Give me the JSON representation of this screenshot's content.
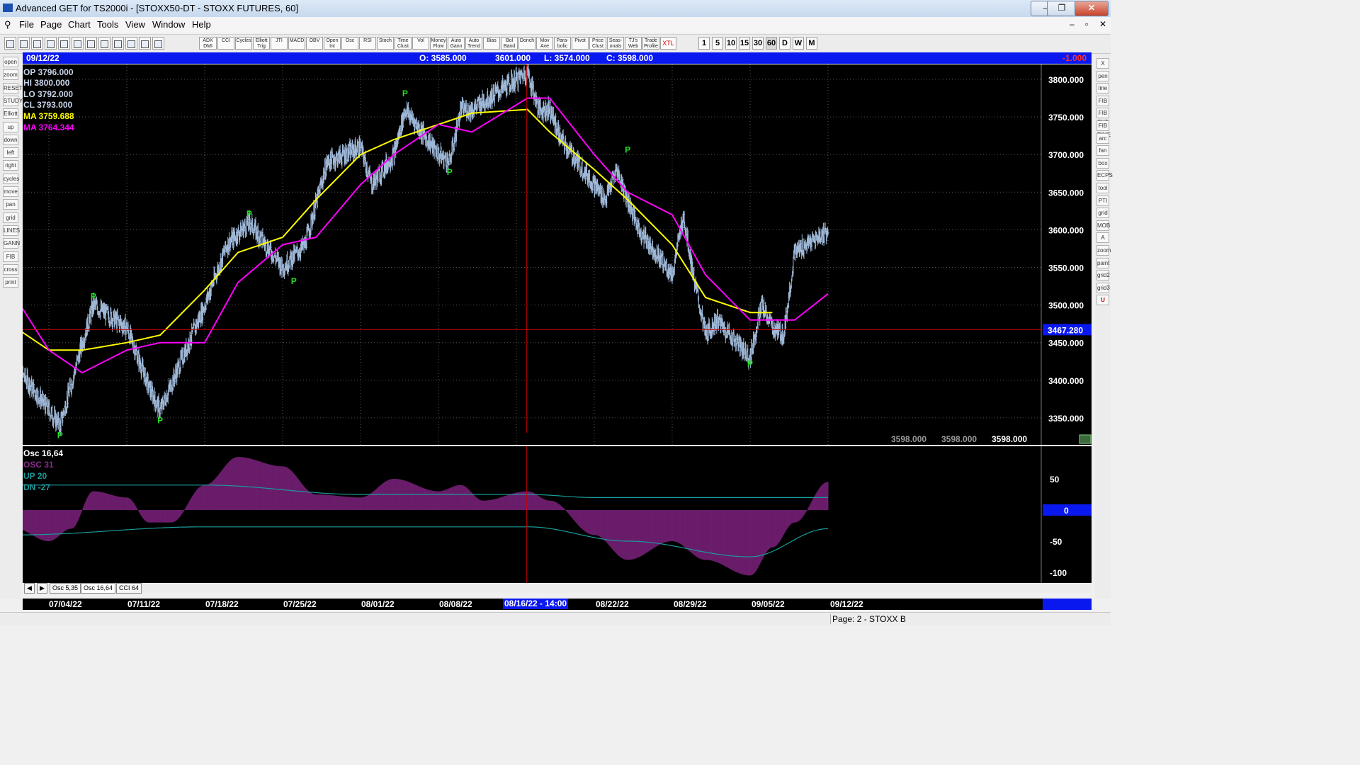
{
  "window": {
    "title": "Advanced GET for TS2000i - [STOXX50-DT - STOXX FUTURES, 60]",
    "controls": [
      "–",
      "❐",
      "✕"
    ],
    "child_controls": [
      "–",
      "▫",
      "✕"
    ]
  },
  "menu": [
    "File",
    "Page",
    "Chart",
    "Tools",
    "View",
    "Window",
    "Help"
  ],
  "toolbar": {
    "indicators": [
      "ADX DMI",
      "CCI",
      "Cycles",
      "Elliott Trig",
      "JTI",
      "MACD",
      "OBV",
      "Open Int",
      "Osc",
      "RSI",
      "Stoch",
      "Time Clust",
      "Vol",
      "Money Flow",
      "Auto Gann",
      "Auto Trend",
      "Bias",
      "Bol Band",
      "Donch",
      "Mov Ave",
      "Para-bolic",
      "Pivot",
      "Price Clust",
      "Seas-onals",
      "TJ's Web",
      "Trade Profile",
      "XTL"
    ],
    "timeframes": [
      "1",
      "5",
      "10",
      "15",
      "30",
      "60",
      "D",
      "W",
      "M"
    ],
    "left_icons": [
      "pin-icon",
      "quote-icon",
      "new-icon",
      "open-icon",
      "prev-icon",
      "next-icon",
      "refresh-icon",
      "grid-icon",
      "save-icon",
      "print-icon",
      "help-icon",
      "help-arrow-icon"
    ]
  },
  "left_tools": [
    "open",
    "zoom",
    "RESET",
    "STUDY",
    "Elliott",
    "up",
    "down",
    "left",
    "right",
    "cycles",
    "move",
    "pan",
    "grid",
    "LINES",
    "GANN",
    "FIB",
    "cross",
    "print"
  ],
  "right_tools": [
    "X",
    "pen",
    "line",
    "FIB RET",
    "FIB EXT",
    "FIB TIME",
    "arc",
    "fan",
    "box",
    "ECPS",
    "tool",
    "PTI",
    "grid",
    "MOB",
    "A",
    "zoom",
    "paint",
    "grid2",
    "grid3",
    "U"
  ],
  "info_bar": {
    "date": "09/12/22",
    "open": "O: 3585.000",
    "high": "3601.000",
    "low": "L: 3574.000",
    "close": "C: 3598.000",
    "change": "-1.000"
  },
  "legend": {
    "op": "OP  3796.000",
    "hi": "HI   3800.000",
    "lo": "LO  3792.000",
    "cl": "CL  3793.000",
    "ma1": "MA  3759.688",
    "ma2": "MA  3764.344",
    "osc_title": "Osc 16,64",
    "osc": "OSC 31",
    "up": "UP  20",
    "dn": "DN  -27"
  },
  "price_axis": {
    "ticks": [
      "3800.000",
      "3750.000",
      "3700.000",
      "3650.000",
      "3600.000",
      "3550.000",
      "3500.000",
      "3450.000",
      "3400.000",
      "3350.000"
    ],
    "cursor_label": "3467.280",
    "bottom_values": [
      "3598.000",
      "3598.000",
      "3598.000"
    ]
  },
  "osc_axis": {
    "ticks": [
      "50",
      "0",
      "-50",
      "-100"
    ]
  },
  "pivot_label": "P",
  "tabs": [
    "Osc 5,35",
    "Osc 16,64",
    "CCI 64"
  ],
  "date_axis": [
    "07/04/22",
    "07/11/22",
    "07/18/22",
    "07/25/22",
    "08/01/22",
    "08/08/22",
    "08/16/22 - 14:00",
    "08/22/22",
    "08/29/22",
    "09/05/22",
    "09/12/22"
  ],
  "status": {
    "page": "Page: 2 - STOXX B"
  },
  "colors": {
    "info_bar": "#0a18f0",
    "bars": "#9fb8d8",
    "ma_yellow": "#ffff00",
    "ma_magenta": "#ff00ff",
    "osc_hist": "#6a1d6a",
    "band": "#1a9a9a",
    "pivot": "#22e022",
    "cursor": "#cc0000"
  },
  "chart_data": {
    "type": "line",
    "x": [
      "07/04/22",
      "07/11/22",
      "07/18/22",
      "07/25/22",
      "08/01/22",
      "08/08/22",
      "08/16/22",
      "08/22/22",
      "08/29/22",
      "09/05/22",
      "09/12/22"
    ],
    "ylim": [
      3330,
      3820
    ],
    "series": [
      {
        "name": "Price (hourly)",
        "points": [
          [
            "07/01/22",
            3420
          ],
          [
            "07/05/22",
            3340
          ],
          [
            "07/07/22",
            3450
          ],
          [
            "07/08/22",
            3500
          ],
          [
            "07/11/22",
            3470
          ],
          [
            "07/13/22",
            3390
          ],
          [
            "07/14/22",
            3360
          ],
          [
            "07/18/22",
            3500
          ],
          [
            "07/20/22",
            3580
          ],
          [
            "07/22/22",
            3610
          ],
          [
            "07/25/22",
            3550
          ],
          [
            "07/27/22",
            3580
          ],
          [
            "07/29/22",
            3690
          ],
          [
            "08/01/22",
            3710
          ],
          [
            "08/02/22",
            3660
          ],
          [
            "08/04/22",
            3700
          ],
          [
            "08/05/22",
            3760
          ],
          [
            "08/08/22",
            3700
          ],
          [
            "08/09/22",
            3690
          ],
          [
            "08/10/22",
            3760
          ],
          [
            "08/11/22",
            3760
          ],
          [
            "08/12/22",
            3770
          ],
          [
            "08/16/22",
            3810
          ],
          [
            "08/17/22",
            3760
          ],
          [
            "08/18/22",
            3760
          ],
          [
            "08/19/22",
            3720
          ],
          [
            "08/22/22",
            3660
          ],
          [
            "08/23/22",
            3640
          ],
          [
            "08/24/22",
            3680
          ],
          [
            "08/25/22",
            3640
          ],
          [
            "08/26/22",
            3600
          ],
          [
            "08/29/22",
            3540
          ],
          [
            "08/30/22",
            3620
          ],
          [
            "08/31/22",
            3530
          ],
          [
            "09/01/22",
            3460
          ],
          [
            "09/02/22",
            3480
          ],
          [
            "09/05/22",
            3430
          ],
          [
            "09/06/22",
            3500
          ],
          [
            "09/07/22",
            3470
          ],
          [
            "09/08/22",
            3460
          ],
          [
            "09/09/22",
            3570
          ],
          [
            "09/12/22",
            3598
          ]
        ]
      },
      {
        "name": "MA 3759.688",
        "points": [
          [
            "07/01/22",
            3470
          ],
          [
            "07/04/22",
            3440
          ],
          [
            "07/07/22",
            3440
          ],
          [
            "07/11/22",
            3450
          ],
          [
            "07/14/22",
            3460
          ],
          [
            "07/18/22",
            3520
          ],
          [
            "07/21/22",
            3570
          ],
          [
            "07/25/22",
            3590
          ],
          [
            "07/28/22",
            3640
          ],
          [
            "08/01/22",
            3700
          ],
          [
            "08/04/22",
            3720
          ],
          [
            "08/08/22",
            3740
          ],
          [
            "08/11/22",
            3755
          ],
          [
            "08/16/22",
            3760
          ],
          [
            "08/18/22",
            3730
          ],
          [
            "08/22/22",
            3680
          ],
          [
            "08/25/22",
            3640
          ],
          [
            "08/29/22",
            3580
          ],
          [
            "09/01/22",
            3510
          ],
          [
            "09/05/22",
            3490
          ],
          [
            "09/07/22",
            3490
          ]
        ]
      },
      {
        "name": "MA 3764.344",
        "points": [
          [
            "07/01/22",
            3510
          ],
          [
            "07/04/22",
            3440
          ],
          [
            "07/07/22",
            3410
          ],
          [
            "07/11/22",
            3440
          ],
          [
            "07/14/22",
            3450
          ],
          [
            "07/18/22",
            3450
          ],
          [
            "07/21/22",
            3530
          ],
          [
            "07/25/22",
            3580
          ],
          [
            "07/28/22",
            3590
          ],
          [
            "08/01/22",
            3660
          ],
          [
            "08/04/22",
            3700
          ],
          [
            "08/08/22",
            3740
          ],
          [
            "08/11/22",
            3730
          ],
          [
            "08/16/22",
            3775
          ],
          [
            "08/18/22",
            3775
          ],
          [
            "08/22/22",
            3700
          ],
          [
            "08/25/22",
            3650
          ],
          [
            "08/29/22",
            3620
          ],
          [
            "09/01/22",
            3540
          ],
          [
            "09/05/22",
            3480
          ],
          [
            "09/09/22",
            3480
          ],
          [
            "09/12/22",
            3515
          ]
        ]
      }
    ],
    "pivots": [
      [
        "07/05/22",
        3340,
        "low"
      ],
      [
        "07/08/22",
        3500,
        "high"
      ],
      [
        "07/14/22",
        3360,
        "low"
      ],
      [
        "07/22/22",
        3610,
        "high"
      ],
      [
        "07/26/22",
        3545,
        "low"
      ],
      [
        "08/05/22",
        3770,
        "high"
      ],
      [
        "08/09/22",
        3690,
        "low"
      ],
      [
        "08/25/22",
        3695,
        "high"
      ],
      [
        "09/05/22",
        3435,
        "low"
      ]
    ],
    "cursor_price": 3467.28,
    "oscillator": {
      "ylim": [
        -115,
        90
      ],
      "values": [
        [
          "07/01/22",
          -30
        ],
        [
          "07/04/22",
          -50
        ],
        [
          "07/06/22",
          -30
        ],
        [
          "07/08/22",
          30
        ],
        [
          "07/11/22",
          20
        ],
        [
          "07/13/22",
          -20
        ],
        [
          "07/15/22",
          -20
        ],
        [
          "07/18/22",
          40
        ],
        [
          "07/21/22",
          85
        ],
        [
          "07/25/22",
          70
        ],
        [
          "07/28/22",
          25
        ],
        [
          "08/01/22",
          20
        ],
        [
          "08/04/22",
          50
        ],
        [
          "08/08/22",
          30
        ],
        [
          "08/10/22",
          40
        ],
        [
          "08/12/22",
          15
        ],
        [
          "08/16/22",
          30
        ],
        [
          "08/18/22",
          15
        ],
        [
          "08/22/22",
          -40
        ],
        [
          "08/25/22",
          -80
        ],
        [
          "08/29/22",
          -50
        ],
        [
          "09/01/22",
          -80
        ],
        [
          "09/05/22",
          -105
        ],
        [
          "09/07/22",
          -60
        ],
        [
          "09/09/22",
          -20
        ],
        [
          "09/12/22",
          45
        ]
      ],
      "up_band": [
        [
          "07/01/22",
          40
        ],
        [
          "07/18/22",
          40
        ],
        [
          "08/01/22",
          25
        ],
        [
          "08/16/22",
          25
        ],
        [
          "08/22/22",
          20
        ],
        [
          "09/12/22",
          20
        ]
      ],
      "dn_band": [
        [
          "07/01/22",
          -40
        ],
        [
          "07/18/22",
          -27
        ],
        [
          "08/16/22",
          -27
        ],
        [
          "08/25/22",
          -50
        ],
        [
          "09/05/22",
          -75
        ],
        [
          "09/12/22",
          -30
        ]
      ]
    }
  }
}
